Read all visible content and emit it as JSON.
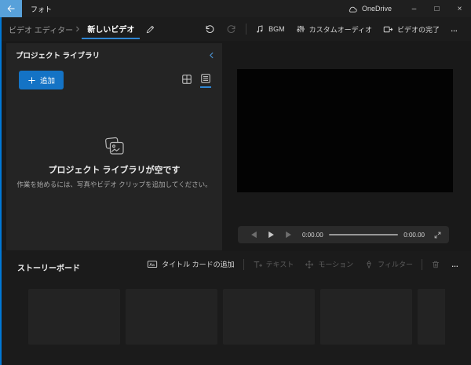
{
  "titlebar": {
    "app_title": "フォト",
    "onedrive_label": "OneDrive",
    "window_controls": {
      "minimize": "–",
      "maximize": "□",
      "close": "×"
    }
  },
  "navbar": {
    "breadcrumb_root": "ビデオ エディター",
    "breadcrumb_separator": "›",
    "breadcrumb_current": "新しいビデオ",
    "bgm_label": "BGM",
    "custom_audio_label": "カスタムオーディオ",
    "finish_video_label": "ビデオの完了",
    "more_label": "…"
  },
  "library": {
    "title": "プロジェクト ライブラリ",
    "add_button_label": "追加",
    "empty_title": "プロジェクト ライブラリが空です",
    "empty_subtitle": "作業を始めるには、写真やビデオ クリップを追加してください。"
  },
  "player": {
    "current_time": "0:00.00",
    "total_time": "0:00.00"
  },
  "storyboard": {
    "title": "ストーリーボード",
    "add_title_card_label": "タイトル カードの追加",
    "text_label": "テキスト",
    "motion_label": "モーション",
    "filter_label": "フィルター",
    "more_label": "…",
    "placeholder_count": 5
  },
  "colors": {
    "accent": "#0078d7",
    "back_button": "#58a1da",
    "add_button": "#1473c5"
  }
}
